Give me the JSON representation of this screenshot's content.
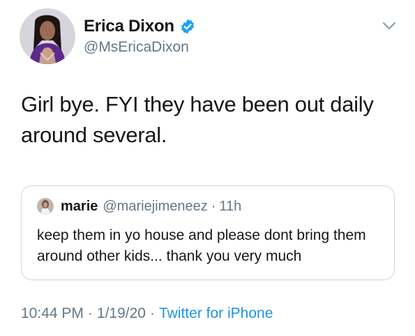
{
  "tweet": {
    "author": {
      "display_name": "Erica Dixon",
      "handle": "@MsEricaDixon",
      "verified": true,
      "verified_color": "#1da1f2"
    },
    "text": "Girl bye. FYI they have been out daily around several.",
    "quoted": {
      "display_name": "marie",
      "handle": "@mariejimeneez",
      "separator": "·",
      "time": "11h",
      "text": "keep them in yo house and please dont bring them around other kids... thank you very much"
    },
    "meta": {
      "time": "10:44 PM",
      "separator": "·",
      "date": "1/19/20",
      "source": "Twitter for iPhone",
      "source_color": "#1b95e0"
    }
  },
  "icons": {
    "menu": "chevron-down-icon",
    "verified": "verified-badge-icon"
  }
}
